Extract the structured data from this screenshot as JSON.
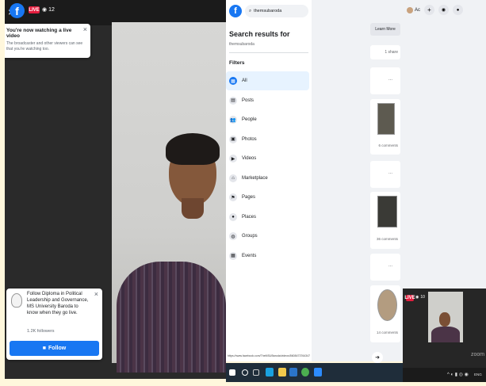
{
  "live": {
    "badge": "LIVE",
    "viewers": "12",
    "notice_title": "You're now watching a live video",
    "notice_body_1": "The broadcaster and other viewers can see",
    "notice_body_2": "that you're watching too.",
    "notice_close": "×",
    "follow_text_1": "Follow Diploma in Political",
    "follow_text_2": "Leadership and Governance,",
    "follow_text_3": "MS University Baroda to",
    "follow_text_4": "know when they go live.",
    "followers": "1.2K followers",
    "follow_close": "×",
    "follow_button": "Follow"
  },
  "search": {
    "query": "themsubaroda",
    "heading": "Search results for",
    "subheading": "themsubaroda",
    "filters_label": "Filters",
    "filters": [
      {
        "label": "All",
        "icon": "grid-icon"
      },
      {
        "label": "Posts",
        "icon": "posts-icon"
      },
      {
        "label": "People",
        "icon": "people-icon"
      },
      {
        "label": "Photos",
        "icon": "photos-icon"
      },
      {
        "label": "Videos",
        "icon": "video-icon"
      },
      {
        "label": "Marketplace",
        "icon": "shop-icon"
      },
      {
        "label": "Pages",
        "icon": "flag-icon"
      },
      {
        "label": "Places",
        "icon": "pin-icon"
      },
      {
        "label": "Groups",
        "icon": "groups-icon"
      },
      {
        "label": "Events",
        "icon": "calendar-icon"
      }
    ],
    "status_url": "https://www.facebook.com/TheMSUBaroda/videos/560847376434701/"
  },
  "topright": {
    "user": "Ac",
    "plus": "+"
  },
  "feed": {
    "learn_more": "Learn More",
    "share": "1 share",
    "more": "...",
    "comments_1": "6 comments",
    "comments_2": "36 comments",
    "comments_3": "14 comments"
  },
  "zoom": {
    "badge": "LIVE",
    "viewers": "10",
    "logo": "zoom"
  },
  "tray": {
    "lang": "ENG"
  },
  "colors": {
    "fb_blue": "#1877f2",
    "live_red": "#e41e3f"
  }
}
